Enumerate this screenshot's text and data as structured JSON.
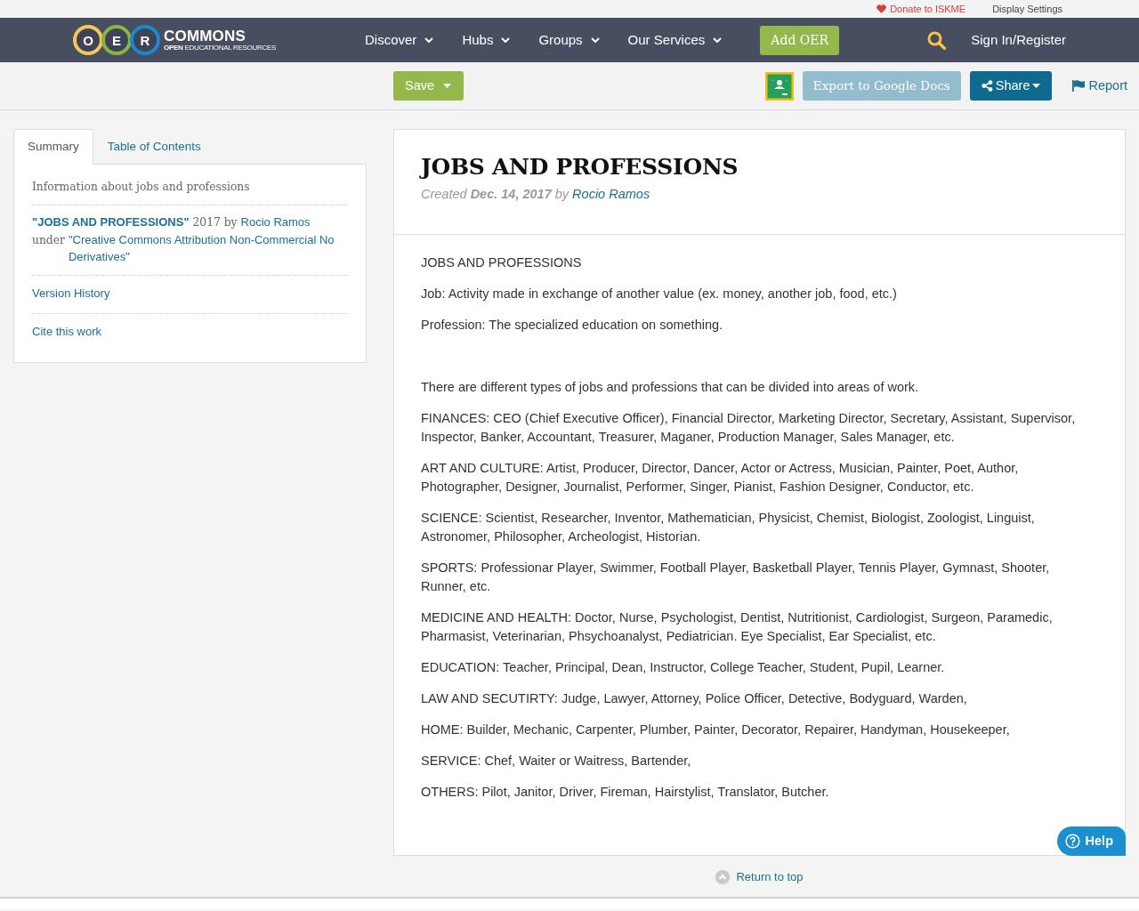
{
  "top_bar": {
    "donate": "Donate to ISKME",
    "display_settings": "Display Settings"
  },
  "navbar": {
    "logo": {
      "letters": [
        {
          "letter": "O",
          "color": "#f5c75b"
        },
        {
          "letter": "E",
          "color": "#8cb445"
        },
        {
          "letter": "R",
          "color": "#1e88cc"
        }
      ],
      "wordmark": "COMMONS",
      "tagline": "**OPEN** EDUCATIONAL RESOURCES"
    },
    "menu": [
      {
        "label": "Discover"
      },
      {
        "label": "Hubs"
      },
      {
        "label": "Groups"
      },
      {
        "label": "Our Services"
      }
    ],
    "add_button": "Add OER",
    "sign_in": "Sign In/Register"
  },
  "toolbar": {
    "save": "Save",
    "export": "Export to Google Docs",
    "share": "Share",
    "report": "Report"
  },
  "sidebar": {
    "tabs": [
      {
        "label": "Summary",
        "selected": true
      },
      {
        "label": "Table of Contents",
        "selected": false
      }
    ],
    "description": "Information about jobs and professions",
    "citation": {
      "title": "\"JOBS AND PROFESSIONS\"",
      "year_by": "2017 by",
      "author": "Rocio Ramos",
      "under": "under",
      "license": "\"Creative Commons Attribution Non-Commercial No Derivatives\""
    },
    "links": [
      "Version History",
      "Cite this work"
    ]
  },
  "resource": {
    "title": "JOBS AND PROFESSIONS",
    "created": "Created **Dec. 14, 2017** by",
    "author": "Rocio Ramos",
    "intro": [
      "JOBS AND PROFESSIONS",
      "Job: Activity made in exchange of another value (ex. money, another job, food, etc.)",
      "Profession: The specialized education on something."
    ],
    "sections": [
      "There are different types of jobs and professions that can be divided into areas of work.",
      "FINANCES: CEO (Chief Executive Officer), Financial Director, Marketing Director, Secretary, Assistant, Supervisor, Inspector, Banker, Accountant, Treasurer, Maganer, Production Manager, Sales Manager, etc.",
      "ART AND CULTURE: Artist, Producer, Director, Dancer, Actor or Actress, Musician, Painter, Poet, Author, Photographer, Designer, Journalist, Performer, Singer, Pianist, Fashion Designer, Conductor, etc.",
      "SCIENCE: Scientist, Researcher, Inventor, Mathematician, Physicist, Chemist, Biologist, Zoologist, Linguist, Astronomer, Philosopher, Archeologist, Historian.",
      "SPORTS: Professionar Player, Swimmer, Football Player, Basketball Player, Tennis Player, Gymnast, Shooter, Runner, etc.",
      "MEDICINE AND HEALTH: Doctor, Nurse, Psychologist, Dentist, Nutritionist, Cardiologist, Surgeon, Paramedic, Pharmasist, Veterinarian, Phsychoanalyst, Pediatrician. Eye Specialist, Ear Specialist, etc.",
      "EDUCATION: Teacher, Principal, Dean, Instructor, College Teacher, Student, Pupil, Learner.",
      "LAW AND SECUTIRTY: Judge, Lawyer, Attorney, Police Officer, Detective, Bodyguard, Warden,",
      "HOME: Builder, Mechanic, Carpenter, Plumber, Painter, Decorator, Repairer, Handyman, Housekeeper,",
      "SERVICE: Chef, Waiter or Waitress, Bartender,",
      "OTHERS: Pilot, Janitor, Driver, Fireman, Hairstylist, Translator, Butcher."
    ]
  },
  "return_to_top": "Return to top",
  "help": "Help"
}
